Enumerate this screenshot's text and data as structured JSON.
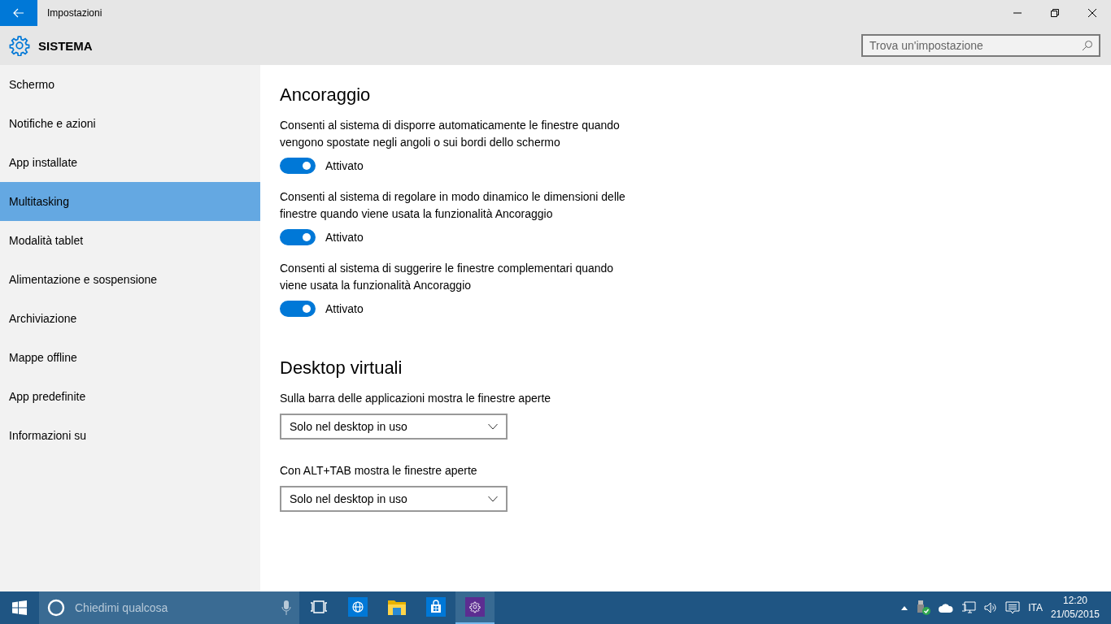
{
  "window": {
    "title": "Impostazioni"
  },
  "header": {
    "title": "SISTEMA",
    "search": {
      "placeholder": "Trova un'impostazione"
    }
  },
  "sidebar": {
    "items": [
      {
        "label": "Schermo",
        "selected": false
      },
      {
        "label": "Notifiche e azioni",
        "selected": false
      },
      {
        "label": "App installate",
        "selected": false
      },
      {
        "label": "Multitasking",
        "selected": true
      },
      {
        "label": "Modalità tablet",
        "selected": false
      },
      {
        "label": "Alimentazione e sospensione",
        "selected": false
      },
      {
        "label": "Archiviazione",
        "selected": false
      },
      {
        "label": "Mappe offline",
        "selected": false
      },
      {
        "label": "App predefinite",
        "selected": false
      },
      {
        "label": "Informazioni su",
        "selected": false
      }
    ]
  },
  "sections": [
    {
      "heading": "Ancoraggio",
      "settings": [
        {
          "kind": "toggle",
          "description": "Consenti al sistema di disporre automaticamente le finestre quando vengono spostate negli angoli o sui bordi dello schermo",
          "on": true,
          "state_label": "Attivato"
        },
        {
          "kind": "toggle",
          "description": "Consenti al sistema di regolare in modo dinamico le dimensioni delle finestre quando viene usata la funzionalità Ancoraggio",
          "on": true,
          "state_label": "Attivato"
        },
        {
          "kind": "toggle",
          "description": "Consenti al sistema di suggerire le finestre complementari quando viene usata la funzionalità Ancoraggio",
          "on": true,
          "state_label": "Attivato"
        }
      ]
    },
    {
      "heading": "Desktop virtuali",
      "settings": [
        {
          "kind": "dropdown",
          "description": "Sulla barra delle applicazioni mostra le finestre aperte",
          "value": "Solo nel desktop in uso"
        },
        {
          "kind": "dropdown",
          "description": "Con ALT+TAB mostra le finestre aperte",
          "value": "Solo nel desktop in uso"
        }
      ]
    }
  ],
  "taskbar": {
    "search": {
      "placeholder": "Chiedimi qualcosa"
    },
    "apps": [
      {
        "kind": "browser",
        "active": false
      },
      {
        "kind": "explorer",
        "active": false
      },
      {
        "kind": "store",
        "active": false
      },
      {
        "kind": "settings",
        "active": true
      }
    ],
    "language": "ITA",
    "time": "12:20",
    "date": "21/05/2015"
  }
}
